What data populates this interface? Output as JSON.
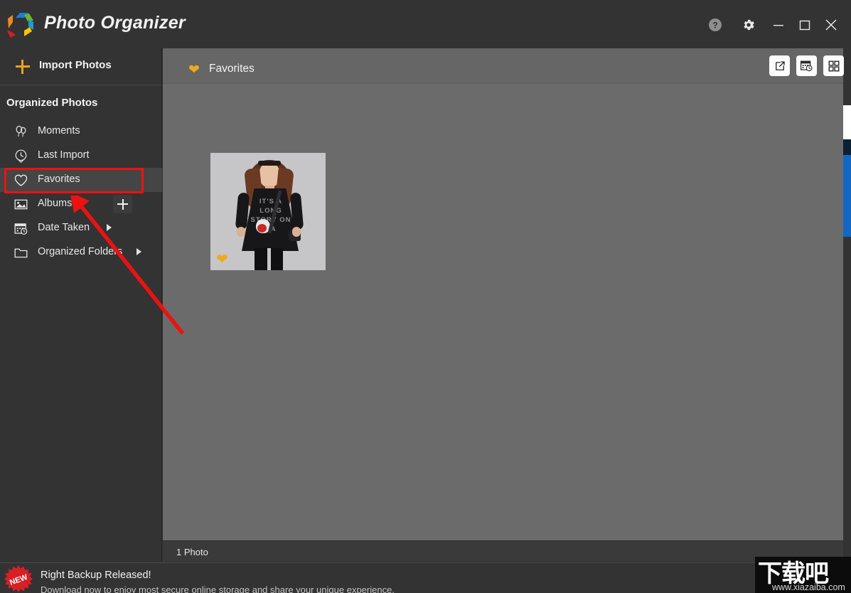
{
  "window": {
    "app_title": "Photo Organizer",
    "logo_icon": "hexagon-pinwheel-logo",
    "logo_colors": [
      "#1a7fd4",
      "#6cb62c",
      "#1f9ad6",
      "#f3c40b",
      "#cf2026",
      "#ef8a1a"
    ],
    "controls": [
      {
        "name": "help-button",
        "icon": "question-circle-icon",
        "label": "?"
      },
      {
        "name": "settings-button",
        "icon": "gear-icon",
        "label": ""
      },
      {
        "name": "minimize-button",
        "icon": "minimize-icon",
        "label": ""
      },
      {
        "name": "maximize-button",
        "icon": "maximize-icon",
        "label": ""
      },
      {
        "name": "close-button",
        "icon": "close-icon",
        "label": ""
      }
    ]
  },
  "sidebar": {
    "import_label": "Import Photos",
    "import_icon": "plus-icon",
    "section_header": "Organized Photos",
    "add_album_icon": "plus-icon",
    "items": [
      {
        "label": "Moments",
        "icon": "balloons-icon",
        "selected": false,
        "caret": false
      },
      {
        "label": "Last Import",
        "icon": "clock-pin-icon",
        "selected": false,
        "caret": false
      },
      {
        "label": "Favorites",
        "icon": "heart-outline-icon",
        "selected": true,
        "caret": false
      },
      {
        "label": "Albums",
        "icon": "image-icon",
        "selected": false,
        "caret": false
      },
      {
        "label": "Date Taken",
        "icon": "calendar-clock-icon",
        "selected": false,
        "caret": true
      },
      {
        "label": "Organized Folders",
        "icon": "folder-icon",
        "selected": false,
        "caret": true
      }
    ]
  },
  "content": {
    "title": "Favorites",
    "title_icon": "heart-filled-icon",
    "title_icon_color": "#f0a81e",
    "header_buttons": [
      {
        "name": "open-external-button",
        "icon": "external-link-icon"
      },
      {
        "name": "date-view-button",
        "icon": "calendar-clock-icon"
      },
      {
        "name": "grid-view-button",
        "icon": "grid-icon"
      }
    ],
    "photos": [
      {
        "name": "photo-thumbnail",
        "favorited": true,
        "favorite_icon": "heart-filled-icon",
        "print_text": "IT'S A LONG STORY ON SA"
      }
    ]
  },
  "statusbar": {
    "count_text": "1 Photo"
  },
  "promo": {
    "badge_text": "NEW",
    "badge_icon": "starburst-badge-icon",
    "title": "Right Backup Released!",
    "subtitle": "Download now to enjoy most secure online storage and share your unique experience."
  },
  "watermark": {
    "brand": "下载吧",
    "url": "www.xiazaiba.com"
  },
  "annotations": {
    "highlight_color": "#ee1111",
    "highlight_target": "Favorites",
    "arrow_target": "Albums"
  }
}
